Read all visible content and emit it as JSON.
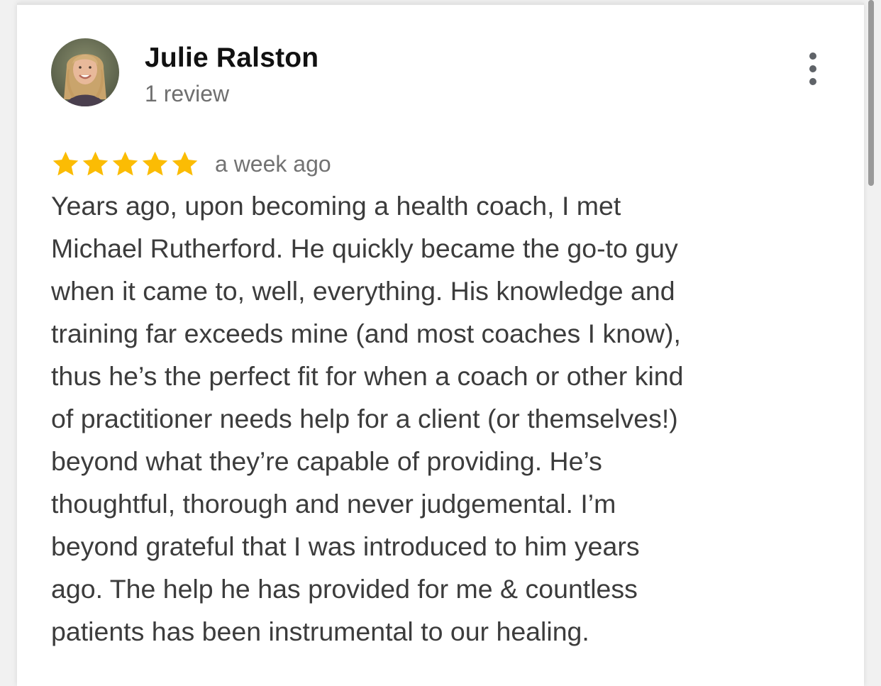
{
  "review": {
    "author_name": "Julie Ralston",
    "review_count": "1 review",
    "rating": 5,
    "max_rating": 5,
    "time": "a week ago",
    "text_lines": [
      "Years ago, upon becoming a health coach, I met",
      "Michael Rutherford. He quickly became the go-to guy",
      "when it came to, well, everything. His knowledge and",
      "training far exceeds mine (and most coaches I know),",
      "thus he’s the perfect fit for when a coach or other kind",
      "of practitioner needs help for a client (or themselves!)",
      "beyond what they’re capable of providing. He’s",
      "thoughtful, thorough and never judgemental. I’m",
      "beyond grateful that I was introduced to him years",
      "ago. The help he has provided for me & countless",
      "patients has been instrumental to our healing."
    ]
  },
  "icons": {
    "star": "star-icon",
    "menu": "more-vert-icon",
    "avatar": "profile-photo"
  },
  "colors": {
    "star": "#fbbc04",
    "name": "#111111",
    "secondary_text": "#6f6f6f",
    "body_text": "#3c3c3c",
    "menu_icon": "#5f6368"
  }
}
